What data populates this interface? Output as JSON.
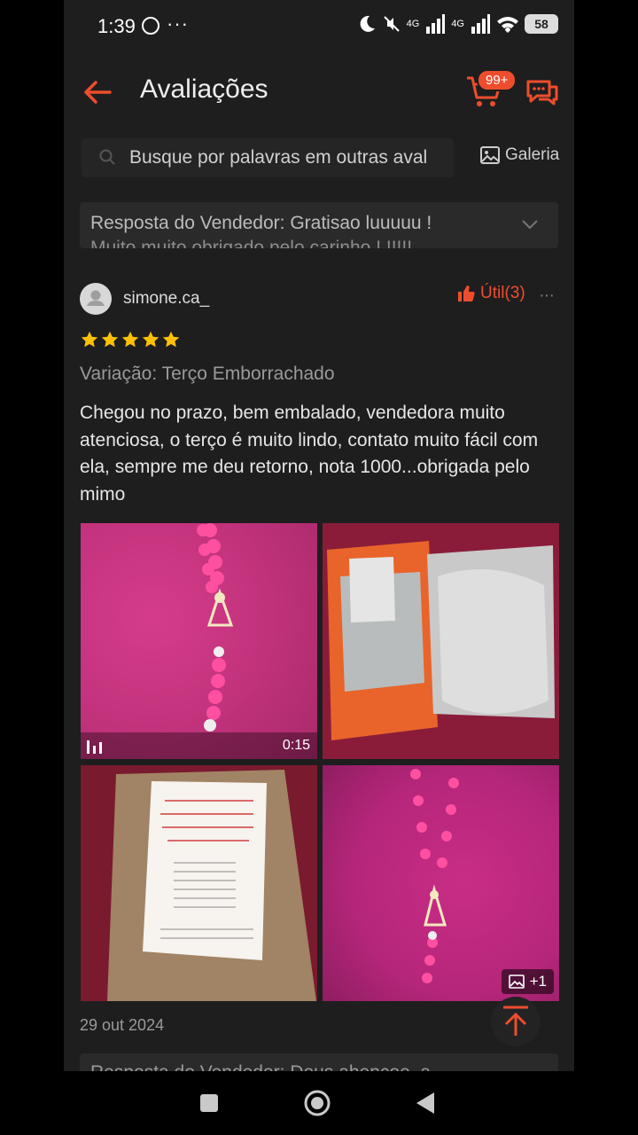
{
  "status_bar": {
    "time": "1:39",
    "dots": "···",
    "battery": "58",
    "network_label": "4G"
  },
  "header": {
    "title": "Avaliações",
    "cart_badge": "99+"
  },
  "search": {
    "placeholder": "Busque por palavras em outras aval",
    "gallery_label": "Galeria"
  },
  "seller_reply_top": {
    "text": "Resposta do Vendedor: Gratisao luuuuu !",
    "text_cut": "Muito muito obrigado pelo carinho ! !!!!!"
  },
  "review": {
    "username": "simone.ca_",
    "helpful_label": "Útil(3)",
    "more": "···",
    "rating": 5,
    "variation": "Variação: Terço Emborrachado",
    "comment": "Chegou no prazo, bem embalado, vendedora muito atenciosa, o terço é muito lindo, contato muito fácil com ela, sempre me deu retorno, nota 1000...obrigada pelo mimo",
    "video_duration": "0:15",
    "extra_media": "+1",
    "date": "29 out 2024"
  },
  "seller_reply_bottom": {
    "text": "Resposta do Vendedor: Deus abençoe, a"
  },
  "colors": {
    "accent": "#ee4d2d",
    "star": "#ffc107",
    "background": "#1e1e1f"
  }
}
